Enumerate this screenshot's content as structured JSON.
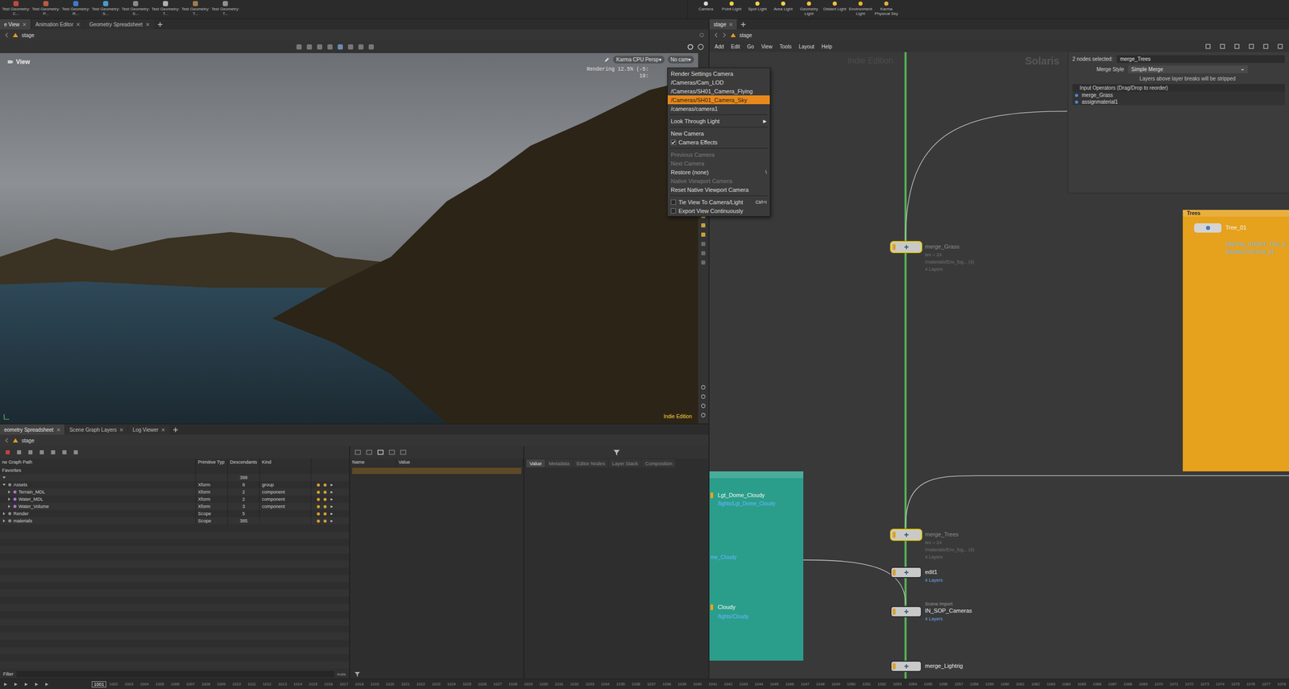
{
  "shelf_left": [
    {
      "label": "Test Geometry: C..."
    },
    {
      "label": "Test Geometry: P..."
    },
    {
      "label": "Test Geometry: R..."
    },
    {
      "label": "Test Geometry: S..."
    },
    {
      "label": "Test Geometry: S..."
    },
    {
      "label": "Test Geometry: T..."
    },
    {
      "label": "Test Geometry: T..."
    },
    {
      "label": "Test Geometry: T..."
    }
  ],
  "shelf_right": [
    {
      "label": "Camera"
    },
    {
      "label": "Point Light"
    },
    {
      "label": "Spot Light"
    },
    {
      "label": "Area Light"
    },
    {
      "label": "Geometry Light"
    },
    {
      "label": "Distant Light"
    },
    {
      "label": "Environment Light"
    },
    {
      "label": "Karma Physical Sky"
    }
  ],
  "left_tabs": [
    {
      "label": "e View",
      "selected": true
    },
    {
      "label": "Animation Editor",
      "selected": false
    },
    {
      "label": "Geometry Spreadsheet",
      "selected": false
    }
  ],
  "viewer": {
    "path": "stage",
    "title": "View",
    "renderer": "Karma CPU Persp▾",
    "camera": "No cam▾",
    "status": [
      "Rendering  12.5%  (-5:",
      "19:"
    ],
    "watermark": "Indie Edition"
  },
  "camera_menu": [
    {
      "kind": "item",
      "label": "Render Settings Camera",
      "selected": false,
      "disabled": false
    },
    {
      "kind": "item",
      "label": "/Cameras/Cam_LOD",
      "selected": false,
      "disabled": false
    },
    {
      "kind": "item",
      "label": "/Cameras/SH01_Camera_Flying",
      "selected": false,
      "disabled": false
    },
    {
      "kind": "item",
      "label": "/Cameras/SH01_Camera_Sky",
      "selected": true,
      "disabled": false
    },
    {
      "kind": "item",
      "label": "/cameras/camera1",
      "selected": false,
      "disabled": false
    },
    {
      "kind": "separator"
    },
    {
      "kind": "submenu",
      "label": "Look Through Light",
      "arrow": "▶",
      "selected": false,
      "disabled": false
    },
    {
      "kind": "separator"
    },
    {
      "kind": "item",
      "label": "New Camera",
      "selected": false,
      "disabled": false
    },
    {
      "kind": "check",
      "label": "Camera Effects",
      "checked": true,
      "selected": false,
      "disabled": false
    },
    {
      "kind": "separator"
    },
    {
      "kind": "item",
      "label": "Previous Camera",
      "selected": false,
      "disabled": true
    },
    {
      "kind": "item",
      "label": "Next Camera",
      "selected": false,
      "disabled": true
    },
    {
      "kind": "item",
      "label": "Restore (none)",
      "shortcut": "\\",
      "selected": false,
      "disabled": false
    },
    {
      "kind": "item",
      "label": "Native Viewport Camera",
      "selected": false,
      "disabled": true
    },
    {
      "kind": "item",
      "label": "Reset Native Viewport Camera",
      "selected": false,
      "disabled": false
    },
    {
      "kind": "separator"
    },
    {
      "kind": "check",
      "label": "Tie View To Camera/Light",
      "shortcut": "Ctrl+I",
      "checked": false,
      "selected": false,
      "disabled": false
    },
    {
      "kind": "check",
      "label": "Export View Continuously",
      "checked": false,
      "selected": false,
      "disabled": false
    }
  ],
  "bottom_tabs": [
    {
      "label": "eometry Spreadsheet",
      "selected": true
    },
    {
      "label": "Scene Graph Layers",
      "selected": false
    },
    {
      "label": "Log Viewer",
      "selected": false
    }
  ],
  "bottom_path": "stage",
  "scene_graph": {
    "columns": [
      "ne Graph Path",
      "Primitive Typ",
      "Descendants",
      "Kind"
    ],
    "rows": [
      {
        "name": "Favorites",
        "depth": 0,
        "toggle": false,
        "expanded": false
      },
      {
        "descendants": "398",
        "depth": 0,
        "toggle": true,
        "expanded": true
      },
      {
        "name": "Assets",
        "type": "Xform",
        "descendants": "8",
        "kind": "group",
        "depth": 0,
        "toggle": true,
        "expanded": true
      },
      {
        "name": "Terrain_MDL",
        "type": "Xform",
        "descendants": "2",
        "kind": "component",
        "depth": 1,
        "toggle": true,
        "expanded": false
      },
      {
        "name": "Water_MDL",
        "type": "Xform",
        "descendants": "2",
        "kind": "component",
        "depth": 1,
        "toggle": true,
        "expanded": false
      },
      {
        "name": "Water_Volume",
        "type": "Xform",
        "descendants": "3",
        "kind": "component",
        "depth": 1,
        "toggle": true,
        "expanded": false
      },
      {
        "name": "Render",
        "type": "Scope",
        "descendants": "5",
        "depth": 0,
        "toggle": true,
        "expanded": false
      },
      {
        "name": "materials",
        "type": "Scope",
        "descendants": "385",
        "depth": 0,
        "toggle": true,
        "expanded": false
      }
    ],
    "filter": "Filter",
    "badge": "Indie"
  },
  "values_table": {
    "columns": [
      "Name",
      "Value"
    ]
  },
  "inspector_tabs": [
    {
      "label": "Value",
      "selected": true
    },
    {
      "label": "Metadata",
      "selected": false
    },
    {
      "label": "Editor Nodes",
      "selected": false
    },
    {
      "label": "Layer Stack",
      "selected": false
    },
    {
      "label": "Composition",
      "selected": false
    }
  ],
  "right_tabs": [
    {
      "label": "stage",
      "selected": true
    }
  ],
  "network_path": "stage",
  "network_menu": [
    "Add",
    "Edit",
    "Go",
    "View",
    "Tools",
    "Layout",
    "Help"
  ],
  "network": {
    "watermark": "Indie Edition",
    "context": "Solaris",
    "nodes": [
      {
        "name": "merge_Grass",
        "info": [
          "tex = 24",
          "/materials/Env_fog... (4)",
          "4 Layers"
        ],
        "selected": true,
        "dim": true
      },
      {
        "name": "merge_Trees",
        "info": [
          "tex = 24",
          "/materials/Env_fog... (4)",
          "4 Layers"
        ],
        "selected": true,
        "dim": true
      },
      {
        "name": "edit1",
        "info": [
          "4 Layers"
        ],
        "selected": false,
        "dim": false
      },
      {
        "name": "IN_SOP_Cameras",
        "type_label": "Scene Import",
        "info": [
          "4 Layers"
        ],
        "selected": false,
        "dim": false
      },
      {
        "name": "merge_Lightrig",
        "info": [],
        "selected": false,
        "dim": false
      }
    ],
    "boxes": [
      {
        "color": "#2a9e8a",
        "entries": [
          {
            "text": "Lgt_Dome_Cloudy",
            "kind": "name"
          },
          {
            "text": "/lights/Lgt_Dome_Cloudy",
            "kind": "path"
          },
          {
            "text": "me_Cloudy",
            "kind": "path"
          },
          {
            "text": "Cloudy",
            "kind": "name"
          },
          {
            "text": "/lights/Cloudy",
            "kind": "path"
          }
        ]
      },
      {
        "title": "Trees",
        "color": "#e6a11d",
        "entries": [
          {
            "text": "Tree_01",
            "kind": "name"
          },
          {
            "text": "/obj/Tree_01/OUT_Tree_0",
            "kind": "path"
          },
          {
            "text": "/Assets/Tree/Tree_01",
            "kind": "path"
          }
        ]
      }
    ]
  },
  "params": {
    "selection_label": "2 nodes selected:",
    "selection": "merge_Trees",
    "merge_style_label": "Merge Style",
    "merge_style": "Simple Merge",
    "note": "Layers above layer breaks will be stripped",
    "inputs_label": "Input Operators (Drag/Drop to reorder)",
    "inputs": [
      "merge_Grass",
      "assignmaterial1"
    ]
  },
  "timeline": {
    "current": "1001",
    "ticks": [
      "1002",
      "1003",
      "1004",
      "1005",
      "1006",
      "1007",
      "1008",
      "1009",
      "1010",
      "1011",
      "1012",
      "1013",
      "1014",
      "1015",
      "1016",
      "1017",
      "1018",
      "1019",
      "1020",
      "1021",
      "1022",
      "1023",
      "1024",
      "1025",
      "1026",
      "1027",
      "1028",
      "1029",
      "1030",
      "1031",
      "1032",
      "1033",
      "1034",
      "1035",
      "1036",
      "1037",
      "1038",
      "1039",
      "1040",
      "1041",
      "1042",
      "1043",
      "1044",
      "1045",
      "1046",
      "1047",
      "1048",
      "1049",
      "1050",
      "1051",
      "1052",
      "1053",
      "1054",
      "1055",
      "1056",
      "1057",
      "1058",
      "1059",
      "1060",
      "1061",
      "1062",
      "1063",
      "1064",
      "1065",
      "1066",
      "1067",
      "1068",
      "1069",
      "1070",
      "1071",
      "1072",
      "1073",
      "1074",
      "1075",
      "1076",
      "1077",
      "1078"
    ]
  }
}
